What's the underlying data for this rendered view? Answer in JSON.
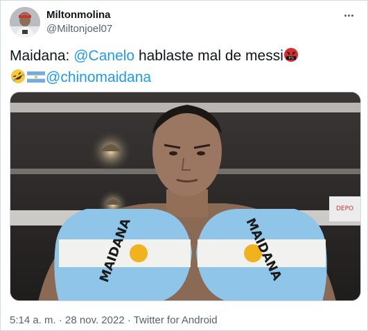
{
  "tweet": {
    "display_name": "Miltonmolina",
    "handle": "@Miltonjoel07",
    "text_line1_prefix": "Maidana: ",
    "mention_1": "@Canelo",
    "text_line1_suffix": " hablaste mal de messi",
    "mention_2": "@chinomaidana",
    "emojis": [
      "angry-cursing-face-emoji",
      "rolling-on-floor-laughing-emoji",
      "argentina-flag-emoji"
    ],
    "timestamp": "5:14 a. m. · 28 nov. 2022 · ",
    "source": "Twitter for Android",
    "photo": {
      "left_glove_text": "MAIDANA",
      "right_glove_text": "MAIDANA",
      "banner_text": "DEPO"
    }
  },
  "colors": {
    "link": "#1d9bf0",
    "text": "#0f1419",
    "secondary": "#536471",
    "border": "#cfd9de",
    "flag_blue": "#8ec5e8"
  }
}
